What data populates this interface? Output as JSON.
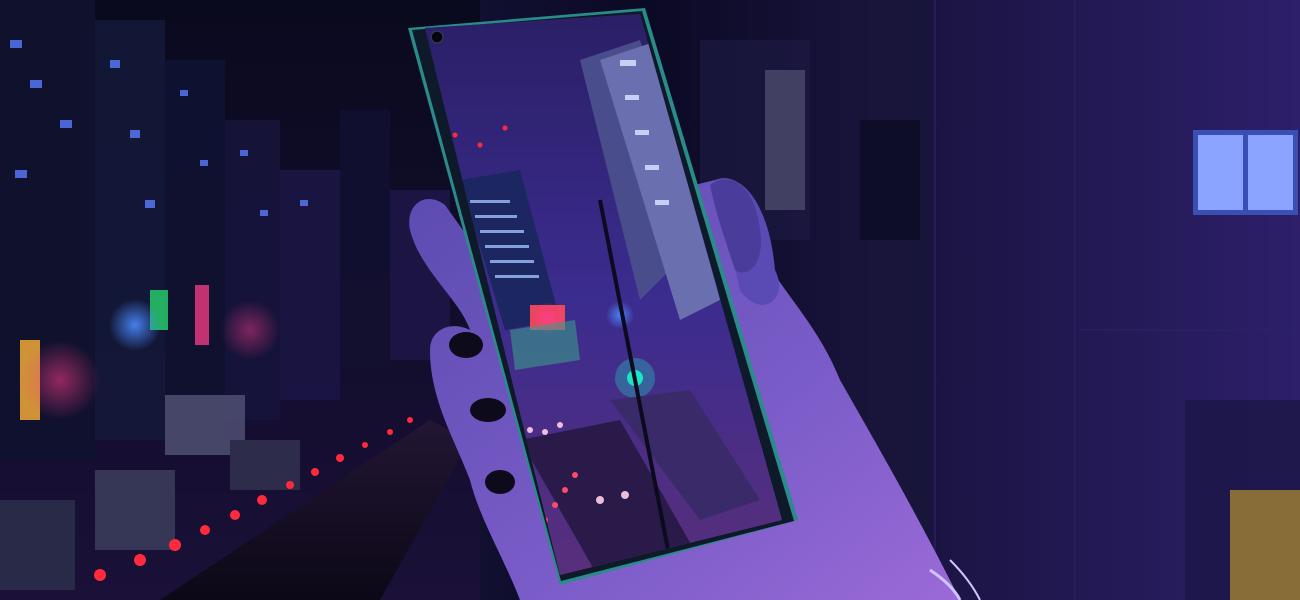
{
  "scene": {
    "description_colors": {
      "background_dark": "#07061a",
      "neon_purple": "#7b3cff",
      "neon_blue": "#3a7bff",
      "neon_pink": "#ff3d8a",
      "street_red": "#ff2a3c",
      "teal_signal": "#19e6c8",
      "phone_frame": "#5fd1c9"
    },
    "icons": {
      "phone": "smartphone-icon",
      "camera": "punch-hole-camera-icon",
      "hand": "hand-icon"
    }
  }
}
